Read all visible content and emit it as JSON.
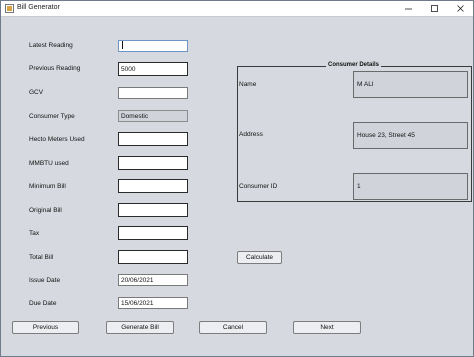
{
  "window": {
    "title": "Bill Generator"
  },
  "form": {
    "fields": [
      {
        "label": "Latest Reading",
        "value": ""
      },
      {
        "label": "Previous Reading",
        "value": "5000"
      },
      {
        "label": "GCV",
        "value": ""
      },
      {
        "label": "Consumer Type",
        "value": "Domestic"
      },
      {
        "label": "Hecto Meters Used",
        "value": ""
      },
      {
        "label": "MMBTU used",
        "value": ""
      },
      {
        "label": "Minimum Bill",
        "value": ""
      },
      {
        "label": "Original Bill",
        "value": ""
      },
      {
        "label": "Tax",
        "value": ""
      },
      {
        "label": "Total Bill",
        "value": ""
      },
      {
        "label": "Issue Date",
        "value": "20/06/2021"
      },
      {
        "label": "Due Date",
        "value": "15/06/2021"
      }
    ]
  },
  "consumer": {
    "title": "Consumer Details",
    "name_label": "Name",
    "name_value": "M ALI",
    "address_label": "Address",
    "address_value": "House 23, Street 45",
    "id_label": "Consumer ID",
    "id_value": "1"
  },
  "buttons": {
    "calculate": "Calculate",
    "previous": "Previous",
    "generate": "Generate Bill",
    "cancel": "Cancel",
    "next": "Next"
  }
}
